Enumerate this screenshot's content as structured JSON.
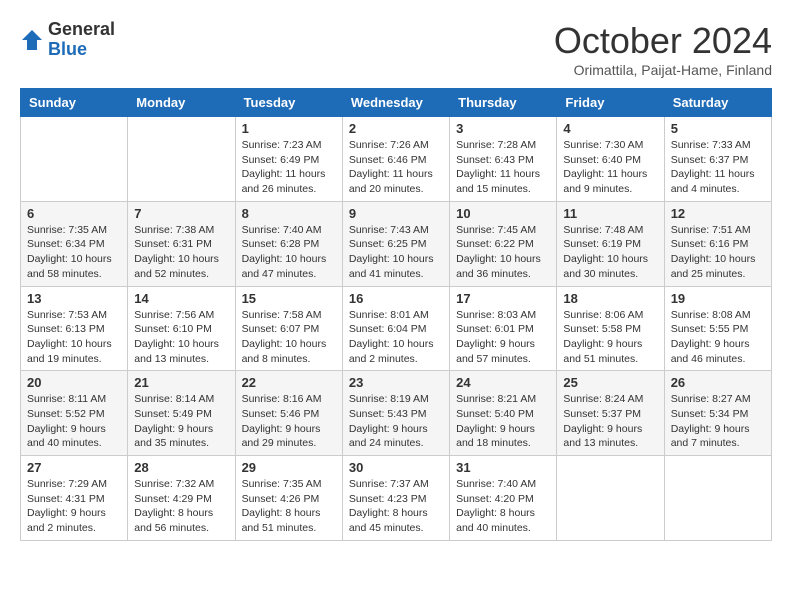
{
  "header": {
    "logo": {
      "general": "General",
      "blue": "Blue"
    },
    "title": "October 2024",
    "subtitle": "Orimattila, Paijat-Hame, Finland"
  },
  "days_of_week": [
    "Sunday",
    "Monday",
    "Tuesday",
    "Wednesday",
    "Thursday",
    "Friday",
    "Saturday"
  ],
  "weeks": [
    [
      {
        "day": "",
        "info": ""
      },
      {
        "day": "",
        "info": ""
      },
      {
        "day": "1",
        "info": "Sunrise: 7:23 AM\nSunset: 6:49 PM\nDaylight: 11 hours\nand 26 minutes."
      },
      {
        "day": "2",
        "info": "Sunrise: 7:26 AM\nSunset: 6:46 PM\nDaylight: 11 hours\nand 20 minutes."
      },
      {
        "day": "3",
        "info": "Sunrise: 7:28 AM\nSunset: 6:43 PM\nDaylight: 11 hours\nand 15 minutes."
      },
      {
        "day": "4",
        "info": "Sunrise: 7:30 AM\nSunset: 6:40 PM\nDaylight: 11 hours\nand 9 minutes."
      },
      {
        "day": "5",
        "info": "Sunrise: 7:33 AM\nSunset: 6:37 PM\nDaylight: 11 hours\nand 4 minutes."
      }
    ],
    [
      {
        "day": "6",
        "info": "Sunrise: 7:35 AM\nSunset: 6:34 PM\nDaylight: 10 hours\nand 58 minutes."
      },
      {
        "day": "7",
        "info": "Sunrise: 7:38 AM\nSunset: 6:31 PM\nDaylight: 10 hours\nand 52 minutes."
      },
      {
        "day": "8",
        "info": "Sunrise: 7:40 AM\nSunset: 6:28 PM\nDaylight: 10 hours\nand 47 minutes."
      },
      {
        "day": "9",
        "info": "Sunrise: 7:43 AM\nSunset: 6:25 PM\nDaylight: 10 hours\nand 41 minutes."
      },
      {
        "day": "10",
        "info": "Sunrise: 7:45 AM\nSunset: 6:22 PM\nDaylight: 10 hours\nand 36 minutes."
      },
      {
        "day": "11",
        "info": "Sunrise: 7:48 AM\nSunset: 6:19 PM\nDaylight: 10 hours\nand 30 minutes."
      },
      {
        "day": "12",
        "info": "Sunrise: 7:51 AM\nSunset: 6:16 PM\nDaylight: 10 hours\nand 25 minutes."
      }
    ],
    [
      {
        "day": "13",
        "info": "Sunrise: 7:53 AM\nSunset: 6:13 PM\nDaylight: 10 hours\nand 19 minutes."
      },
      {
        "day": "14",
        "info": "Sunrise: 7:56 AM\nSunset: 6:10 PM\nDaylight: 10 hours\nand 13 minutes."
      },
      {
        "day": "15",
        "info": "Sunrise: 7:58 AM\nSunset: 6:07 PM\nDaylight: 10 hours\nand 8 minutes."
      },
      {
        "day": "16",
        "info": "Sunrise: 8:01 AM\nSunset: 6:04 PM\nDaylight: 10 hours\nand 2 minutes."
      },
      {
        "day": "17",
        "info": "Sunrise: 8:03 AM\nSunset: 6:01 PM\nDaylight: 9 hours\nand 57 minutes."
      },
      {
        "day": "18",
        "info": "Sunrise: 8:06 AM\nSunset: 5:58 PM\nDaylight: 9 hours\nand 51 minutes."
      },
      {
        "day": "19",
        "info": "Sunrise: 8:08 AM\nSunset: 5:55 PM\nDaylight: 9 hours\nand 46 minutes."
      }
    ],
    [
      {
        "day": "20",
        "info": "Sunrise: 8:11 AM\nSunset: 5:52 PM\nDaylight: 9 hours\nand 40 minutes."
      },
      {
        "day": "21",
        "info": "Sunrise: 8:14 AM\nSunset: 5:49 PM\nDaylight: 9 hours\nand 35 minutes."
      },
      {
        "day": "22",
        "info": "Sunrise: 8:16 AM\nSunset: 5:46 PM\nDaylight: 9 hours\nand 29 minutes."
      },
      {
        "day": "23",
        "info": "Sunrise: 8:19 AM\nSunset: 5:43 PM\nDaylight: 9 hours\nand 24 minutes."
      },
      {
        "day": "24",
        "info": "Sunrise: 8:21 AM\nSunset: 5:40 PM\nDaylight: 9 hours\nand 18 minutes."
      },
      {
        "day": "25",
        "info": "Sunrise: 8:24 AM\nSunset: 5:37 PM\nDaylight: 9 hours\nand 13 minutes."
      },
      {
        "day": "26",
        "info": "Sunrise: 8:27 AM\nSunset: 5:34 PM\nDaylight: 9 hours\nand 7 minutes."
      }
    ],
    [
      {
        "day": "27",
        "info": "Sunrise: 7:29 AM\nSunset: 4:31 PM\nDaylight: 9 hours\nand 2 minutes."
      },
      {
        "day": "28",
        "info": "Sunrise: 7:32 AM\nSunset: 4:29 PM\nDaylight: 8 hours\nand 56 minutes."
      },
      {
        "day": "29",
        "info": "Sunrise: 7:35 AM\nSunset: 4:26 PM\nDaylight: 8 hours\nand 51 minutes."
      },
      {
        "day": "30",
        "info": "Sunrise: 7:37 AM\nSunset: 4:23 PM\nDaylight: 8 hours\nand 45 minutes."
      },
      {
        "day": "31",
        "info": "Sunrise: 7:40 AM\nSunset: 4:20 PM\nDaylight: 8 hours\nand 40 minutes."
      },
      {
        "day": "",
        "info": ""
      },
      {
        "day": "",
        "info": ""
      }
    ]
  ]
}
